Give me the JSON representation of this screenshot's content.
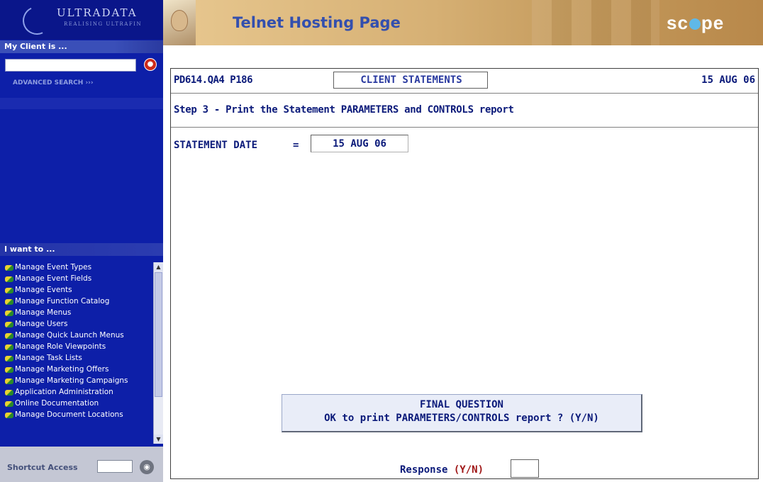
{
  "sidebar": {
    "logo": {
      "brand": "ULTRADATA",
      "tagline": "REALISING ULTRAFIN"
    },
    "client_section": {
      "heading": "My Client is ...",
      "search_placeholder": "",
      "advanced_search": "ADVANCED SEARCH",
      "advanced_chevrons": "›››"
    },
    "iwant_section": {
      "heading": "I want to ...",
      "items": [
        {
          "label": "Manage Event Types"
        },
        {
          "label": "Manage Event Fields"
        },
        {
          "label": "Manage Events"
        },
        {
          "label": "Manage Function Catalog"
        },
        {
          "label": "Manage Menus"
        },
        {
          "label": "Manage Users"
        },
        {
          "label": "Manage Quick Launch Menus"
        },
        {
          "label": "Manage Role Viewpoints"
        },
        {
          "label": "Manage Task Lists"
        },
        {
          "label": "Manage Marketing Offers"
        },
        {
          "label": "Manage Marketing Campaigns"
        },
        {
          "label": "Application Administration"
        },
        {
          "label": "Online Documentation"
        },
        {
          "label": "Manage Document Locations"
        }
      ],
      "scroll_up_icon": "▲",
      "scroll_down_icon": "▼"
    },
    "shortcut": {
      "label": "Shortcut Access",
      "value": "",
      "go_icon": "◉"
    }
  },
  "header": {
    "title": "Telnet Hosting Page",
    "brand_left": "sc",
    "brand_right": "pe"
  },
  "terminal": {
    "program_id": "PD614.QA4 P186",
    "screen_title": "CLIENT STATEMENTS",
    "date": "15 AUG 06",
    "step": "Step 3 - Print the Statement PARAMETERS and CONTROLS report",
    "statement_date_label": "STATEMENT DATE",
    "statement_date_eq": "=",
    "statement_date_value": "15 AUG 06",
    "final_question_title": "FINAL QUESTION",
    "final_question_text": "OK to print PARAMETERS/CONTROLS report ?  (Y/N)",
    "response_label": "Response ",
    "response_options": "(Y/N)",
    "response_value": ""
  },
  "colors": {
    "sidebar_bg": "#0d1fa8",
    "header_title": "#334fae",
    "terminal_text": "#0b1a7a",
    "response_options": "#a01818"
  }
}
